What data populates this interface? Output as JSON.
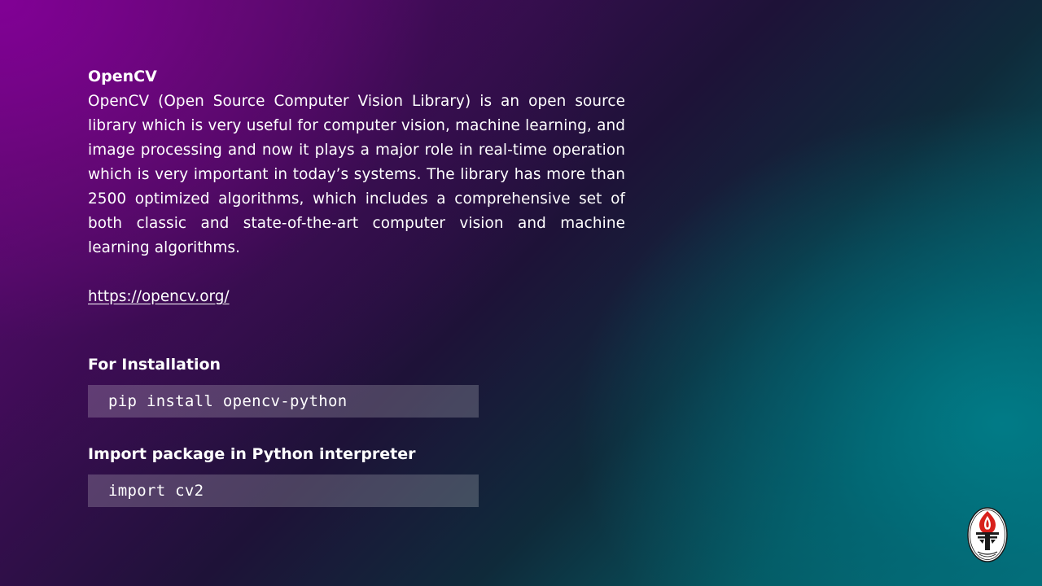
{
  "opencv": {
    "title": "OpenCV",
    "description": "OpenCV (Open Source Computer Vision Library) is an open source library which is very useful for computer vision, machine learning, and image processing and now it plays a major role in real-time operation which is very important in today’s systems. The library has more than 2500 optimized algorithms, which includes a comprehensive set of both classic and state-of-the-art computer vision and machine learning algorithms.",
    "link": "https://opencv.org/"
  },
  "installation": {
    "heading": "For Installation",
    "command": "pip install opencv-python"
  },
  "import_section": {
    "heading": "Import package in Python interpreter",
    "command": "import cv2"
  },
  "colors": {
    "purple": "#6e0a86",
    "teal": "#066f78",
    "code_bg": "rgba(255,255,255,0.2)",
    "logo_red": "#d8201c"
  },
  "icons": {
    "logo": "university-emblem-icon"
  }
}
